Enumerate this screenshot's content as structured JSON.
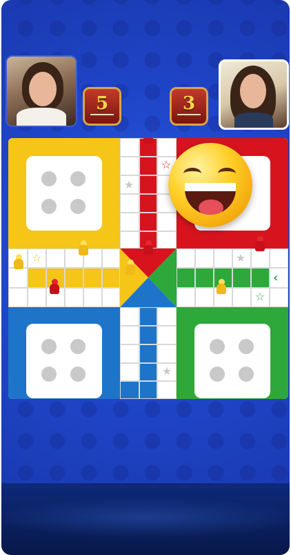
{
  "players": {
    "left": {
      "name": "",
      "level": "5"
    },
    "right": {
      "name": "",
      "level": "3"
    }
  },
  "board": {
    "colors": {
      "yellow": "#f5c518",
      "red": "#d7141e",
      "blue": "#1e74c8",
      "green": "#2ea83a"
    },
    "home_dice_face": 4,
    "reaction_emoji": "laughing-emoji"
  },
  "icons": {
    "arrow": "‹",
    "star": "☆"
  }
}
